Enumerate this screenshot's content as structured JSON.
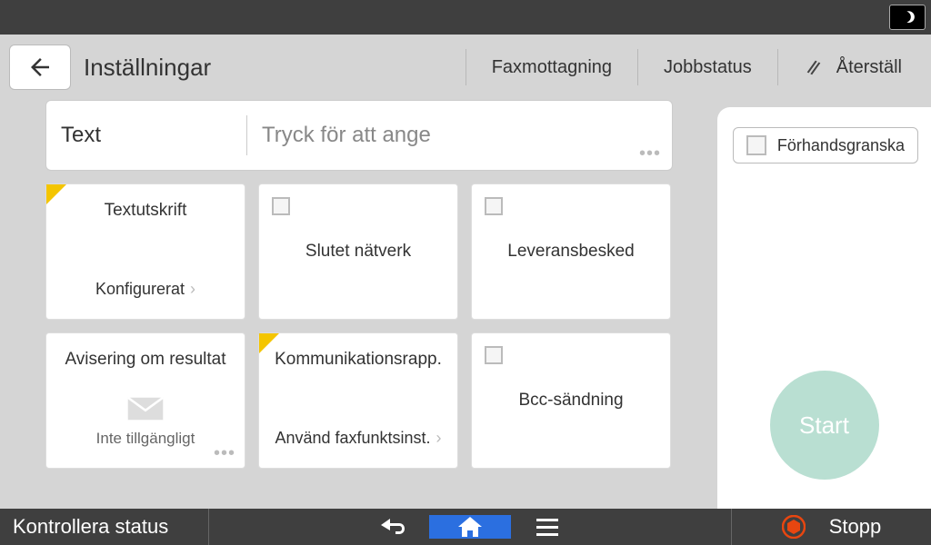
{
  "header": {
    "title": "Inställningar",
    "fax_reception": "Faxmottagning",
    "job_status": "Jobbstatus",
    "reset": "Återställ"
  },
  "textbar": {
    "label": "Text",
    "placeholder": "Tryck för att ange"
  },
  "tiles": {
    "textprint": {
      "title": "Textutskrift",
      "sub": "Konfigurerat"
    },
    "closed_net": {
      "label": "Slutet nätverk"
    },
    "delivery": {
      "label": "Leveransbesked"
    },
    "result_notif": {
      "title": "Avisering om resultat",
      "sub": "Inte tillgängligt"
    },
    "comm_report": {
      "title": "Kommunikationsrapp.",
      "sub": "Använd faxfunktsinst."
    },
    "bcc": {
      "label": "Bcc-sändning"
    }
  },
  "sidebar": {
    "preview": "Förhandsgranska",
    "start": "Start"
  },
  "bottombar": {
    "status": "Kontrollera status",
    "stop": "Stopp"
  }
}
